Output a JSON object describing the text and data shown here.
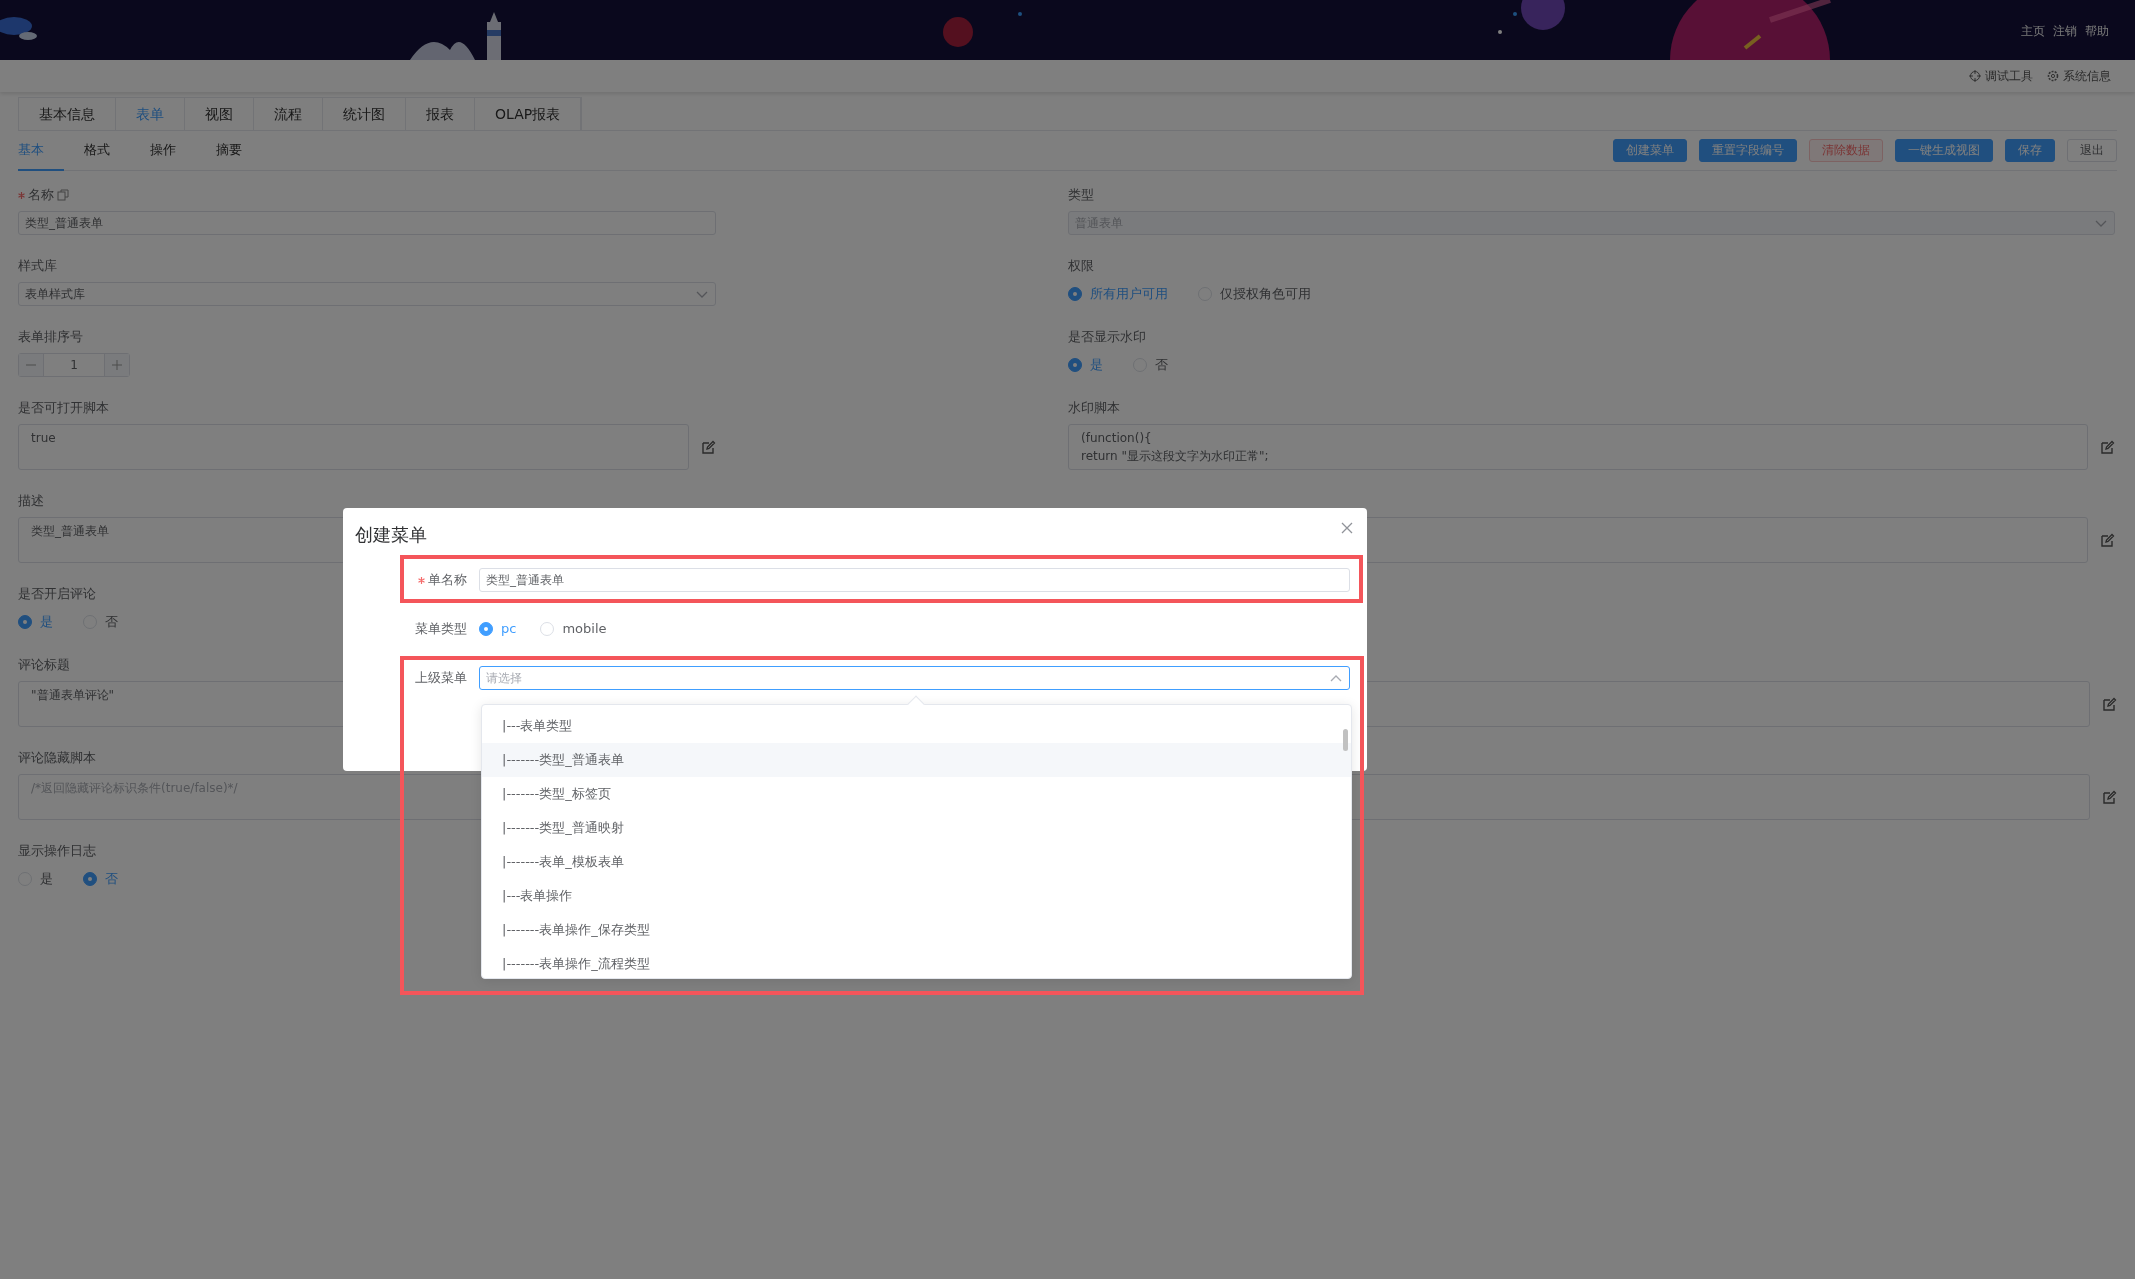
{
  "header": {
    "links": [
      "主页",
      "注销",
      "帮助"
    ]
  },
  "toolbar": {
    "links": [
      "调试工具",
      "系统信息"
    ]
  },
  "tabs": [
    {
      "label": "基本信息",
      "selected": false
    },
    {
      "label": "表单",
      "selected": true
    },
    {
      "label": "视图",
      "selected": false
    },
    {
      "label": "流程",
      "selected": false
    },
    {
      "label": "统计图",
      "selected": false
    },
    {
      "label": "报表",
      "selected": false
    },
    {
      "label": "OLAP报表",
      "selected": false
    }
  ],
  "subtabs": [
    {
      "label": "基本",
      "selected": true
    },
    {
      "label": "格式",
      "selected": false
    },
    {
      "label": "操作",
      "selected": false
    },
    {
      "label": "摘要",
      "selected": false
    }
  ],
  "actions": [
    {
      "label": "创建菜单",
      "kind": "primary"
    },
    {
      "label": "重置字段编号",
      "kind": "primary"
    },
    {
      "label": "清除数据",
      "kind": "danger"
    },
    {
      "label": "一键生成视图",
      "kind": "primary"
    },
    {
      "label": "保存",
      "kind": "primary"
    },
    {
      "label": "退出",
      "kind": "default"
    }
  ],
  "form": {
    "left": [
      {
        "kind": "input",
        "label": "名称",
        "required": true,
        "copy": true,
        "value": "类型_普通表单"
      },
      {
        "kind": "select",
        "label": "样式库",
        "value": "表单样式库",
        "disabled": false
      },
      {
        "kind": "number",
        "label": "表单排序号",
        "value": "1"
      },
      {
        "kind": "textarea",
        "label": "是否可打开脚本",
        "value": "true",
        "edit": true
      },
      {
        "kind": "textarea",
        "label": "描述",
        "value": "类型_普通表单",
        "edit": false
      }
    ],
    "right": [
      {
        "kind": "select",
        "label": "类型",
        "value": "普通表单",
        "disabled": true
      },
      {
        "kind": "radio",
        "label": "权限",
        "options": [
          {
            "label": "所有用户可用",
            "selected": true
          },
          {
            "label": "仅授权角色可用",
            "selected": false
          }
        ]
      },
      {
        "kind": "radio",
        "label": "是否显示水印",
        "options": [
          {
            "label": "是",
            "selected": true
          },
          {
            "label": "否",
            "selected": false
          }
        ]
      },
      {
        "kind": "textarea",
        "label": "水印脚本",
        "value": "(function(){\nreturn \"显示这段文字为水印正常\";",
        "edit": true
      },
      {
        "kind": "textarea",
        "edit": true
      }
    ],
    "wide": [
      {
        "kind": "radio",
        "label": "是否开启评论",
        "options": [
          {
            "label": "是",
            "selected": true
          },
          {
            "label": "否",
            "selected": false
          }
        ]
      },
      {
        "kind": "textarea",
        "label": "评论标题",
        "value": "\"普通表单评论\"",
        "edit": true
      },
      {
        "kind": "textarea",
        "label": "评论隐藏脚本",
        "placeholder": "/*返回隐藏评论标识条件(true/false)*/",
        "edit": true
      },
      {
        "kind": "radio",
        "label": "显示操作日志",
        "options": [
          {
            "label": "是",
            "selected": false
          },
          {
            "label": "否",
            "selected": true
          }
        ]
      }
    ]
  },
  "modal": {
    "title": "创建菜单",
    "fields": [
      {
        "kind": "input",
        "label": "单名称",
        "required": true,
        "value": "类型_普通表单"
      },
      {
        "kind": "radio",
        "label": "菜单类型",
        "options": [
          {
            "label": "pc",
            "selected": true
          },
          {
            "label": "mobile",
            "selected": false
          }
        ]
      },
      {
        "kind": "select",
        "label": "上级菜单",
        "placeholder": "请选择",
        "expanded": true
      }
    ],
    "dropdown": [
      {
        "label": "|---表单类型",
        "highlighted": false
      },
      {
        "label": "|-------类型_普通表单",
        "highlighted": true
      },
      {
        "label": "|-------类型_标签页",
        "highlighted": false
      },
      {
        "label": "|-------类型_普通映射",
        "highlighted": false
      },
      {
        "label": "|-------表单_模板表单",
        "highlighted": false
      },
      {
        "label": "|---表单操作",
        "highlighted": false
      },
      {
        "label": "|-------表单操作_保存类型",
        "highlighted": false
      },
      {
        "label": "|-------表单操作_流程类型",
        "highlighted": false
      }
    ]
  }
}
